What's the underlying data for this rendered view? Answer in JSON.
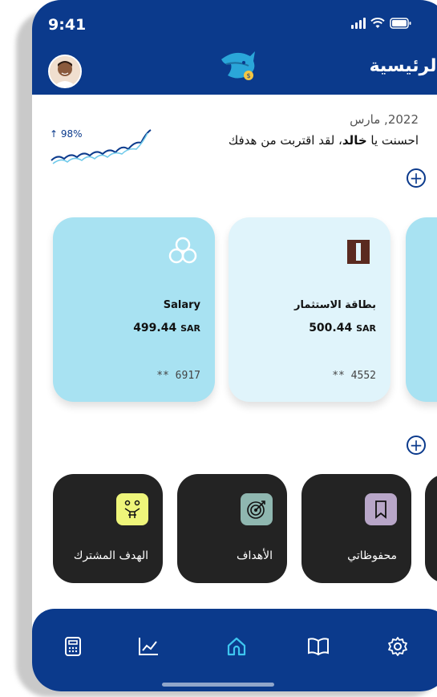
{
  "status_bar": {
    "time": "9:41"
  },
  "header": {
    "title": "الرئيسية",
    "avatar": "user-avatar",
    "logo": "shark-logo"
  },
  "greeting": {
    "date": "2022, مارس",
    "prefix": "احسنت يا ",
    "name": "خالد",
    "suffix": "، لقد اقتربت من هدفك",
    "progress": "98%",
    "progress_icon": "arrow-up-icon"
  },
  "cards": [
    {
      "name": "Salary",
      "amount": "499.44",
      "currency": "SAR",
      "number": "** 6917",
      "icon": "hexagon-logo-icon",
      "color": "#a8e2f2"
    },
    {
      "name": "بطاقة الاستثمار",
      "amount": "500.44",
      "currency": "SAR",
      "number": "** 4552",
      "icon": "bank-door-icon",
      "color": "#e0f4fb"
    }
  ],
  "tiles": [
    {
      "label": "الهدف المشترك",
      "icon": "shared-goal-icon",
      "icon_bg": "#eef57a"
    },
    {
      "label": "الأهداف",
      "icon": "target-icon",
      "icon_bg": "#8fb7b0"
    },
    {
      "label": "محفوظاتي",
      "icon": "bookmark-icon",
      "icon_bg": "#b8a6c8"
    }
  ],
  "nav": [
    {
      "name": "calculator-icon"
    },
    {
      "name": "chart-icon"
    },
    {
      "name": "home-icon",
      "active": true
    },
    {
      "name": "book-icon"
    },
    {
      "name": "settings-icon"
    }
  ],
  "colors": {
    "primary": "#0b3a8c",
    "active_nav": "#3ec6f0",
    "tile_bg": "#232323"
  }
}
